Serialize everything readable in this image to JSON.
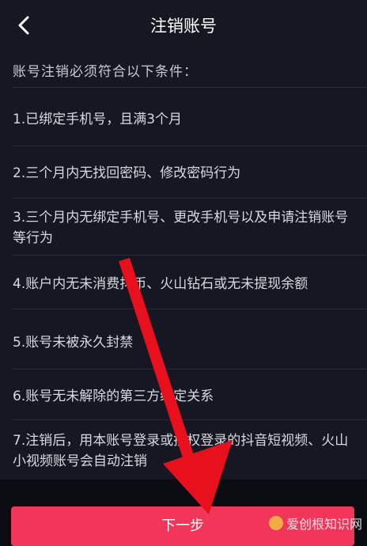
{
  "header": {
    "title": "注销账号"
  },
  "content": {
    "intro": "账号注销必须符合以下条件：",
    "conditions": [
      "1.已绑定手机号，且满3个月",
      "2.三个月内无找回密码、修改密码行为",
      "3.三个月内无绑定手机号、更改手机号以及申请注销账号等行为",
      "4.账户内无未消费抖币、火山钻石或无未提现余额",
      "5.账号未被永久封禁",
      "6.账号无未解除的第三方绑定关系",
      "7.注销后，用本账号登录或授权登录的抖音短视频、火山小视频账号会自动注销"
    ]
  },
  "footer": {
    "next_label": "下一步"
  },
  "watermark": {
    "text": "爱创根知识网"
  },
  "colors": {
    "accent": "#f2355a",
    "arrow": "#e8101c",
    "background": "#161722"
  },
  "icons": {
    "back": "chevron-left-icon"
  }
}
